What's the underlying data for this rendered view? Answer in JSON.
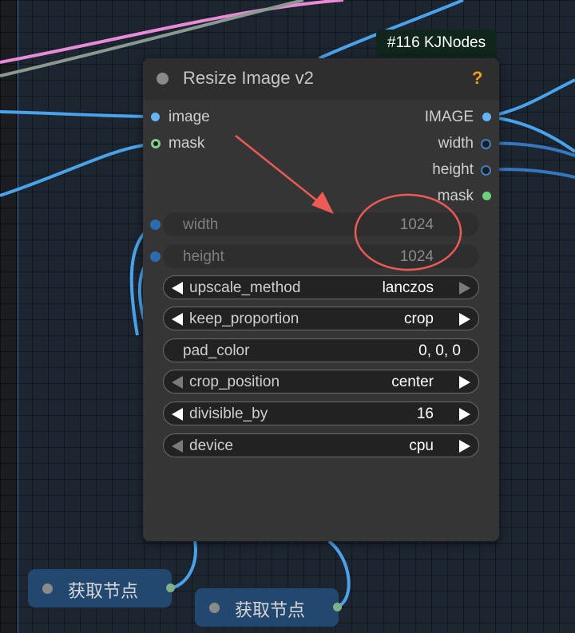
{
  "badge": {
    "text": "#116 KJNodes"
  },
  "node": {
    "title": "Resize Image v2",
    "help_icon": "?",
    "inputs": [
      {
        "label": "image",
        "kind": "blue"
      },
      {
        "label": "mask",
        "kind": "green-ring"
      }
    ],
    "outputs": [
      {
        "label": "IMAGE",
        "kind": "blue"
      },
      {
        "label": "width",
        "kind": "navy"
      },
      {
        "label": "height",
        "kind": "navy"
      },
      {
        "label": "mask",
        "kind": "green"
      }
    ],
    "widgets": [
      {
        "name": "width",
        "value": "1024",
        "state": "converted-input"
      },
      {
        "name": "height",
        "value": "1024",
        "state": "converted-input"
      },
      {
        "name": "upscale_method",
        "value": "lanczos",
        "type": "combo"
      },
      {
        "name": "keep_proportion",
        "value": "crop",
        "type": "combo"
      },
      {
        "name": "pad_color",
        "value": "0, 0, 0",
        "type": "text"
      },
      {
        "name": "crop_position",
        "value": "center",
        "type": "combo"
      },
      {
        "name": "divisible_by",
        "value": "16",
        "type": "number"
      },
      {
        "name": "device",
        "value": "cpu",
        "type": "combo"
      }
    ]
  },
  "get_nodes": [
    {
      "label": "获取节点"
    },
    {
      "label": "获取节点"
    }
  ],
  "colors": {
    "link_blue": "#4aa3ea",
    "link_pink": "#e98ad9",
    "link_gray": "#8a9a90",
    "annotation_red": "#ee5a55",
    "help_orange": "#f0a020"
  }
}
